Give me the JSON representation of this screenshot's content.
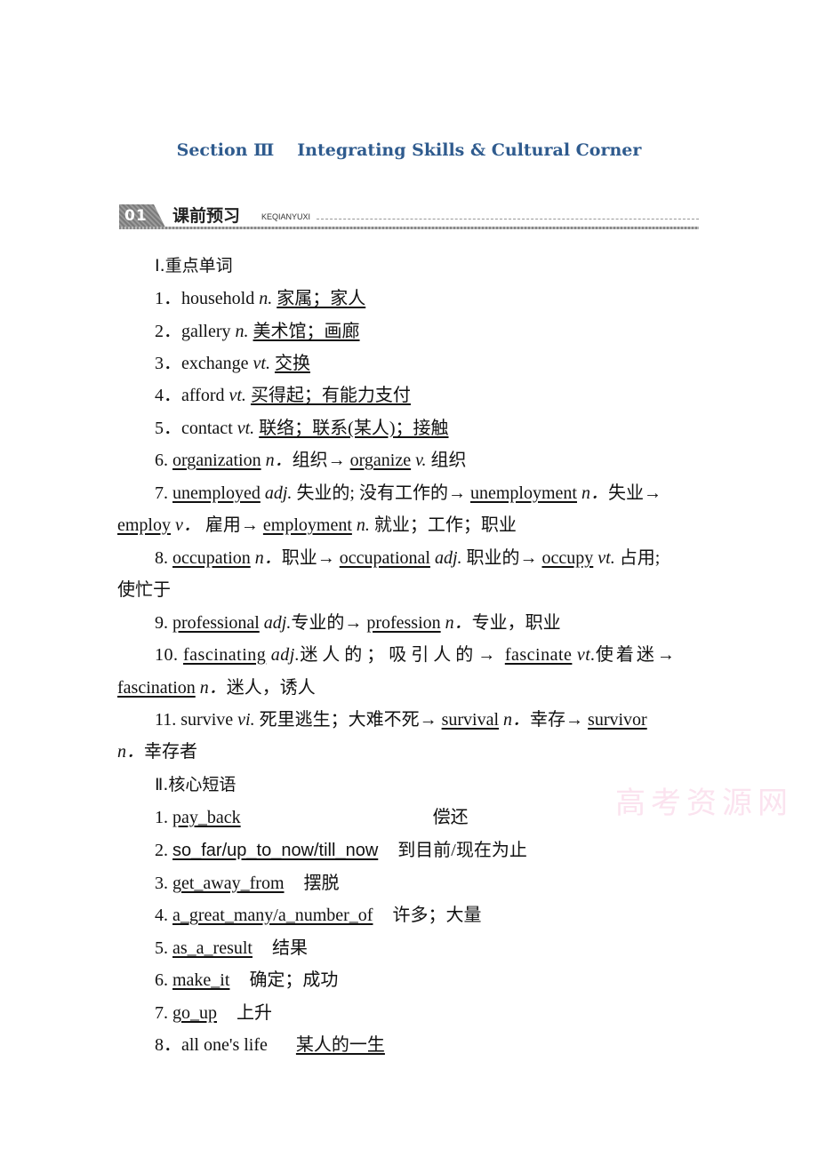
{
  "header": {
    "section": "Section Ⅲ",
    "title": "Integrating Skills & Cultural Corner"
  },
  "banner": {
    "number": "01",
    "title": "课前预习",
    "subtitle": "KEQIANYUXI"
  },
  "part1": {
    "heading": "Ⅰ.重点单词",
    "items": [
      {
        "num": "1．",
        "word": "household",
        "pos": "n.",
        "answer": "家属；家人"
      },
      {
        "num": "2．",
        "word": "gallery",
        "pos": "n.",
        "answer": "美术馆；画廊"
      },
      {
        "num": "3．",
        "word": "exchange",
        "pos": "vt.",
        "answer": "交换"
      },
      {
        "num": "4．",
        "word": "afford",
        "pos": "vt.",
        "answer": "买得起；有能力支付"
      },
      {
        "num": "5．",
        "word": "contact",
        "pos": "vt.",
        "answer": "联络；联系(某人)；接触"
      }
    ],
    "item6": {
      "num": "6.",
      "w1": "organization",
      "p1": "n．",
      "m1": "组织→",
      "w2": "organize",
      "p2": "v.",
      "m2": "组织"
    },
    "item7": {
      "num": "7.",
      "w1": "unemployed",
      "p1": "adj.",
      "m1": "失业的; 没有工作的→",
      "w2": "unemployment",
      "p2": "n．",
      "m2": "失业→",
      "w3": "employ",
      "p3": "v．",
      "m3": "雇用→",
      "w4": "employment",
      "p4": "n.",
      "m4": "就业；工作；职业"
    },
    "item8": {
      "num": "8.",
      "w1": "occupation",
      "p1": "n．",
      "m1": "职业→",
      "w2": "occupational",
      "p2": "adj.",
      "m2": "职业的→",
      "w3": "occupy",
      "p3": "vt.",
      "m3": "占用;",
      "m3b": "使忙于"
    },
    "item9": {
      "num": "9.",
      "w1": "professional",
      "p1": "adj.",
      "m1": "专业的→",
      "w2": "profession",
      "p2": "n．",
      "m2": "专业，职业"
    },
    "item10": {
      "num": "10.",
      "w1": "fascinating",
      "p1": "adj.",
      "m1": "迷人的；吸引人的→",
      "w2": "fascinate",
      "p2": "vt.",
      "m2": "使着迷→",
      "w3": "fascination",
      "p3": "n．",
      "m3": "迷人，诱人"
    },
    "item11": {
      "num": "11.",
      "w0": "survive",
      "p0": "vi.",
      "m0": "死里逃生；大难不死→",
      "w1": "survival",
      "p1": "n．",
      "m1": "幸存→",
      "w2": "survivor",
      "p2": "n．",
      "m2": "幸存者"
    }
  },
  "part2": {
    "heading": "Ⅱ.核心短语",
    "items": [
      {
        "num": "1.",
        "phrase": "pay_back",
        "meaning": "偿还"
      },
      {
        "num": "2.",
        "phrase": "so_far/up_to_now/till_now",
        "meaning": "到目前/现在为止"
      },
      {
        "num": "3.",
        "phrase": "get_away_from",
        "meaning": "摆脱"
      },
      {
        "num": "4.",
        "phrase": "a_great_many/a_number_of",
        "meaning": "许多；大量"
      },
      {
        "num": "5.",
        "phrase": "as_a_result",
        "meaning": "结果"
      },
      {
        "num": "6.",
        "phrase": "make_it",
        "meaning": "确定；成功"
      },
      {
        "num": "7.",
        "phrase": "go_up",
        "meaning": "上升"
      }
    ],
    "item8": {
      "num": "8．",
      "phrase": "all one's life",
      "meaning": "某人的一生"
    }
  },
  "watermark": "高考资源网"
}
